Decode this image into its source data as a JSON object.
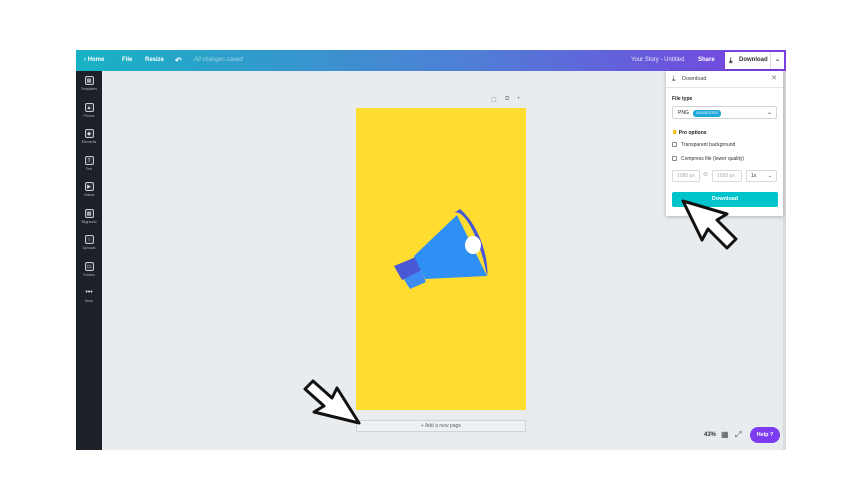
{
  "topbar": {
    "home": "Home",
    "file": "File",
    "resize": "Resize",
    "save_status": "All changes saved",
    "doc_title": "Your Story - Untitled",
    "share": "Share",
    "download": "Download"
  },
  "sidebar": {
    "items": [
      {
        "label": "Templates",
        "icon": "templates-icon"
      },
      {
        "label": "Photos",
        "icon": "photos-icon"
      },
      {
        "label": "Elements",
        "icon": "elements-icon"
      },
      {
        "label": "Text",
        "icon": "text-icon"
      },
      {
        "label": "Videos",
        "icon": "videos-icon"
      },
      {
        "label": "Bkground",
        "icon": "background-icon"
      },
      {
        "label": "Uploads",
        "icon": "uploads-icon"
      },
      {
        "label": "Folders",
        "icon": "folders-icon"
      },
      {
        "label": "More",
        "icon": "more-icon"
      }
    ]
  },
  "canvas": {
    "add_page": "+ Add a new page",
    "page_color": "#fedd30"
  },
  "footer": {
    "zoom": "43%",
    "help": "Help ?"
  },
  "download_panel": {
    "title": "Download",
    "file_type_label": "File type",
    "file_type_value": "PNG",
    "file_type_badge": "SUGGESTED",
    "pro_options_label": "Pro options",
    "transparent_label": "Transparent background",
    "compress_label": "Compress file (lower quality)",
    "width": "1080 px",
    "height": "1920 px",
    "scale": "1x",
    "download_button": "Download"
  },
  "colors": {
    "accent": "#00c4cc",
    "purple": "#7d3cf0",
    "megaphone_blue": "#3d8cf5"
  }
}
